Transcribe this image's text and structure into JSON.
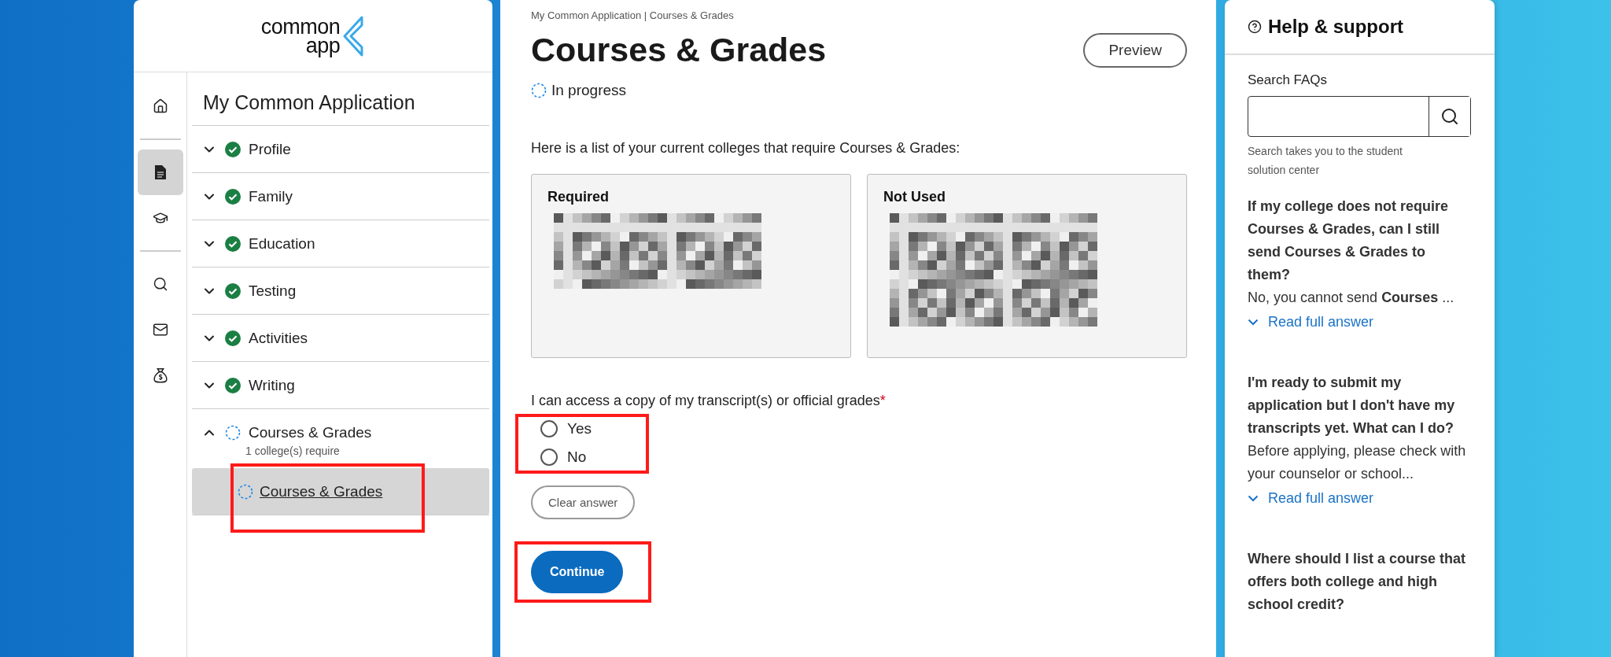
{
  "logo": {
    "line_1": "common",
    "line_2": "app"
  },
  "rail": [
    {
      "kind": "home",
      "selected": false
    },
    {
      "kind": "document",
      "selected": true
    },
    {
      "kind": "cap",
      "selected": false
    },
    {
      "kind": "search",
      "selected": false
    },
    {
      "kind": "mail",
      "selected": false
    },
    {
      "kind": "moneybag",
      "selected": false
    }
  ],
  "nav": {
    "title": "My Common Application",
    "items": [
      {
        "label": "Profile",
        "kind": "complete",
        "expanded": false
      },
      {
        "label": "Family",
        "kind": "complete",
        "expanded": false
      },
      {
        "label": "Education",
        "kind": "complete",
        "expanded": false
      },
      {
        "label": "Testing",
        "kind": "complete",
        "expanded": false
      },
      {
        "label": "Activities",
        "kind": "complete",
        "expanded": false
      },
      {
        "label": "Writing",
        "kind": "complete",
        "expanded": false
      },
      {
        "label": "Courses & Grades",
        "kind": "in_progress",
        "expanded": true,
        "note": "1 college(s) require",
        "children": [
          {
            "label": "Courses & Grades",
            "kind": "in_progress",
            "selected": true,
            "highlighted": true
          }
        ]
      }
    ]
  },
  "main": {
    "breadcrumb": "My Common Application | Courses & Grades",
    "title": "Courses & Grades",
    "preview_button": "Preview",
    "status": {
      "label": "In progress",
      "kind": "in_progress"
    },
    "intro": "Here is a list of your current colleges that require Courses & Grades:",
    "cards": [
      {
        "heading": "Required"
      },
      {
        "heading": "Not Used"
      }
    ],
    "question": {
      "label": "I can access a copy of my transcript(s) or official grades",
      "required_mark": "*",
      "highlighted": true,
      "options": [
        {
          "label": "Yes",
          "selected": false
        },
        {
          "label": "No",
          "selected": false
        }
      ]
    },
    "clear_button": "Clear answer",
    "continue_button": {
      "label": "Continue",
      "highlighted": true
    }
  },
  "help": {
    "title": "Help & support",
    "search": {
      "label": "Search FAQs",
      "hint": "Search takes you to the student solution center"
    },
    "faqs": [
      {
        "question": "If my college does not require Courses & Grades, can I still send Courses & Grades to them?",
        "answer": "No, you cannot send **Courses** ...",
        "link": "Read full answer"
      },
      {
        "question": "I'm ready to submit my application but I don't have my transcripts yet. What can I do?",
        "answer": "Before applying, please check with your counselor or school...",
        "link": "Read full answer"
      },
      {
        "question": "Where should I list a course that offers both college and high school credit?"
      }
    ]
  }
}
